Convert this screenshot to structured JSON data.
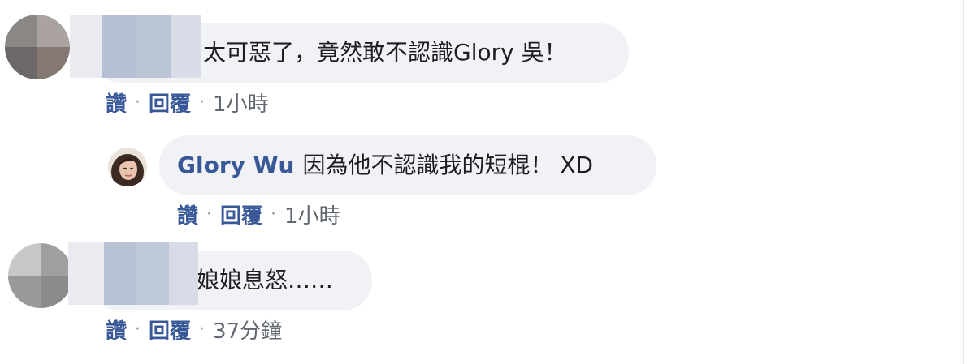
{
  "comments": [
    {
      "text": "太可惡了，竟然敢不認識Glory 吳！",
      "actions": {
        "like": "讚",
        "reply": "回覆",
        "sep": "·",
        "time": "1小時"
      }
    },
    {
      "author": "Glory Wu",
      "text": "因為他不認識我的短棍！ XD",
      "actions": {
        "like": "讚",
        "reply": "回覆",
        "sep": "·",
        "time": "1小時"
      }
    },
    {
      "text": "娘娘息怒……",
      "actions": {
        "like": "讚",
        "reply": "回覆",
        "sep": "·",
        "time": "37分鐘"
      }
    }
  ],
  "colors": {
    "bubble_bg": "#f0f2f5",
    "link_blue": "#385898",
    "meta_gray": "#606770"
  }
}
